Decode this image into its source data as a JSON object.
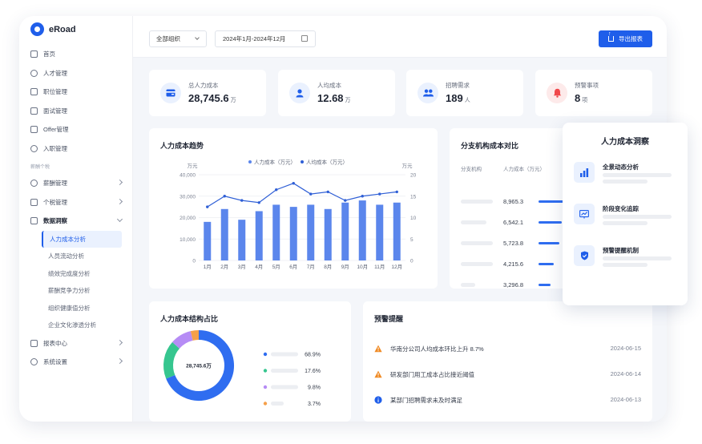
{
  "app": {
    "name": "eRoad"
  },
  "sidebar": {
    "items": [
      {
        "label": "首页",
        "icon": "home-icon",
        "arrow": ""
      },
      {
        "label": "人才管理",
        "icon": "people-icon",
        "arrow": ""
      },
      {
        "label": "职位管理",
        "icon": "building-icon",
        "arrow": ""
      },
      {
        "label": "面试管理",
        "icon": "clipboard-icon",
        "arrow": ""
      },
      {
        "label": "Offer管理",
        "icon": "document-icon",
        "arrow": ""
      },
      {
        "label": "入职管理",
        "icon": "user-plus-icon",
        "arrow": ""
      }
    ],
    "section_label": "薪酬个税",
    "items2": [
      {
        "label": "薪酬管理",
        "icon": "money-icon",
        "arrow": "right"
      },
      {
        "label": "个税管理",
        "icon": "tax-icon",
        "arrow": "right"
      },
      {
        "label": "数据洞察",
        "icon": "bar-chart-icon",
        "arrow": "down"
      }
    ],
    "sub_items": [
      "人力成本分析",
      "人员流动分析",
      "绩效完成度分析",
      "薪酬竞争力分析",
      "组织健康值分析",
      "企业文化渗透分析"
    ],
    "items3": [
      {
        "label": "报表中心",
        "icon": "report-icon",
        "arrow": "right"
      },
      {
        "label": "系统设置",
        "icon": "gear-icon",
        "arrow": "right"
      }
    ]
  },
  "topbar": {
    "org_select": "全部组织",
    "date_range": "2024年1月-2024年12月",
    "export_label": "导出报表"
  },
  "kpis": [
    {
      "label": "总人力成本",
      "value": "28,745.6",
      "unit": "万",
      "icon": "wallet-icon",
      "color": "#1f5eea",
      "bg": "#eaf1fe"
    },
    {
      "label": "人均成本",
      "value": "12.68",
      "unit": "万",
      "icon": "user-icon",
      "color": "#1f5eea",
      "bg": "#eaf1fe"
    },
    {
      "label": "招聘需求",
      "value": "189",
      "unit": "人",
      "icon": "group-icon",
      "color": "#1f5eea",
      "bg": "#eaf1fe"
    },
    {
      "label": "预警事项",
      "value": "8",
      "unit": "项",
      "icon": "bell-icon",
      "color": "#f0494c",
      "bg": "#fdeaea"
    }
  ],
  "trend": {
    "title": "人力成本趋势",
    "left_unit": "万元",
    "right_unit": "万元"
  },
  "chart_data": [
    {
      "type": "bar",
      "title": "人力成本趋势",
      "categories": [
        "1月",
        "2月",
        "3月",
        "4月",
        "5月",
        "6月",
        "7月",
        "8月",
        "9月",
        "10月",
        "11月",
        "12月"
      ],
      "series": [
        {
          "name": "人力成本（万元）",
          "type": "bar",
          "axis": "left",
          "values": [
            18000,
            24000,
            19000,
            23000,
            26000,
            25000,
            26000,
            24000,
            27000,
            28000,
            26000,
            27000
          ]
        },
        {
          "name": "人均成本（万元）",
          "type": "line",
          "axis": "right",
          "values": [
            12.5,
            15,
            14,
            13.5,
            16.5,
            18,
            15.5,
            16,
            14,
            15,
            15.5,
            16
          ]
        }
      ],
      "ylim_left": [
        0,
        40000
      ],
      "yticks_left": [
        "0",
        "10,000",
        "20,000",
        "30,000",
        "40,000"
      ],
      "ylim_right": [
        0,
        20
      ],
      "yticks_right": [
        "0",
        "5",
        "10",
        "15",
        "20"
      ],
      "ylabel": "万元",
      "ylabel_right": "万元",
      "legend": "top-center",
      "grid": true,
      "colors": [
        "#5b86ec",
        "#2f5fd6"
      ]
    },
    {
      "type": "pie",
      "title": "人力成本结构占比",
      "center_label": "28,745.6万",
      "values": [
        68.9,
        17.6,
        9.8,
        3.7
      ],
      "value_labels": [
        "68.9%",
        "17.6%",
        "9.8%",
        "3.7%"
      ],
      "colors": [
        "#2f6df0",
        "#36c68f",
        "#b68cf5",
        "#f5a04a"
      ]
    },
    {
      "type": "bar",
      "title": "分支机构成本对比",
      "columns": [
        "分支机构",
        "人力成本（万元）"
      ],
      "values": [
        8965.3,
        6542.1,
        5723.8,
        4215.6,
        3296.8
      ],
      "value_labels": [
        "8,965.3",
        "6,542.1",
        "5,723.8",
        "4,215.6",
        "3,296.8"
      ],
      "colors": [
        "#2f6df0"
      ]
    }
  ],
  "insight": {
    "title": "人力成本洞察",
    "items": [
      {
        "label": "全景动态分析",
        "icon": "bar-chart-icon"
      },
      {
        "label": "阶段变化追踪",
        "icon": "trend-icon"
      },
      {
        "label": "预警提醒机制",
        "icon": "shield-icon"
      }
    ]
  },
  "warnings": {
    "title": "预警提醒",
    "items": [
      {
        "text": "华南分公司人均成本环比上升 8.7%",
        "date": "2024-06-15",
        "icon": "warning-icon",
        "color": "#f08a24"
      },
      {
        "text": "研发部门用工成本占比接近阈值",
        "date": "2024-06-14",
        "icon": "warning-icon",
        "color": "#f08a24"
      },
      {
        "text": "某部门招聘需求未及时满足",
        "date": "2024-06-13",
        "icon": "info-icon",
        "color": "#1f5eea"
      }
    ]
  }
}
